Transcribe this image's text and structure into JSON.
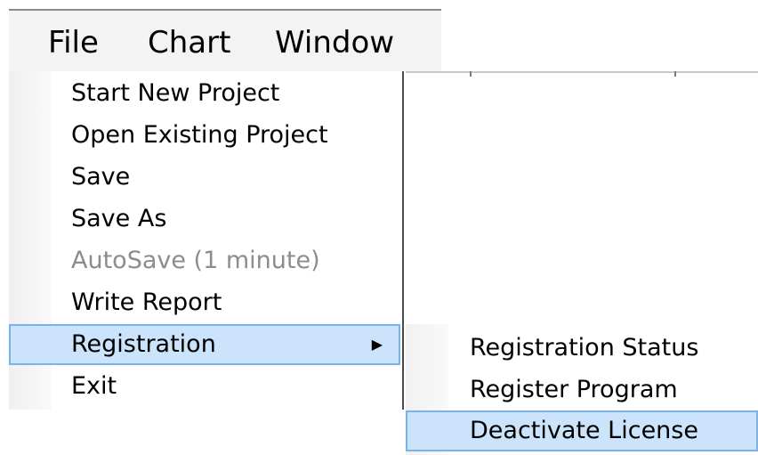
{
  "menubar": {
    "items": [
      {
        "label": "File"
      },
      {
        "label": "Chart"
      },
      {
        "label": "Window"
      }
    ]
  },
  "file_menu": {
    "items": [
      {
        "label": "Start New Project",
        "enabled": true
      },
      {
        "label": "Open Existing Project",
        "enabled": true
      },
      {
        "label": "Save",
        "enabled": true
      },
      {
        "label": "Save As",
        "enabled": true
      },
      {
        "label": "AutoSave (1 minute)",
        "enabled": false
      },
      {
        "label": "Write Report",
        "enabled": true
      },
      {
        "label": "Registration",
        "enabled": true,
        "highlighted": true,
        "has_submenu": true,
        "arrow_icon": "chevron-right-icon",
        "arrow_glyph": "▶"
      },
      {
        "label": "Exit",
        "enabled": true
      }
    ]
  },
  "registration_submenu": {
    "items": [
      {
        "label": "Registration Status"
      },
      {
        "label": "Register Program"
      },
      {
        "label": "Deactivate License",
        "highlighted": true
      }
    ]
  },
  "colors": {
    "highlight_fill": "#cce4fb",
    "highlight_border": "#7ab3ea",
    "disabled_text": "#8c8c8c",
    "menubar_bg": "#f3f3f3"
  }
}
